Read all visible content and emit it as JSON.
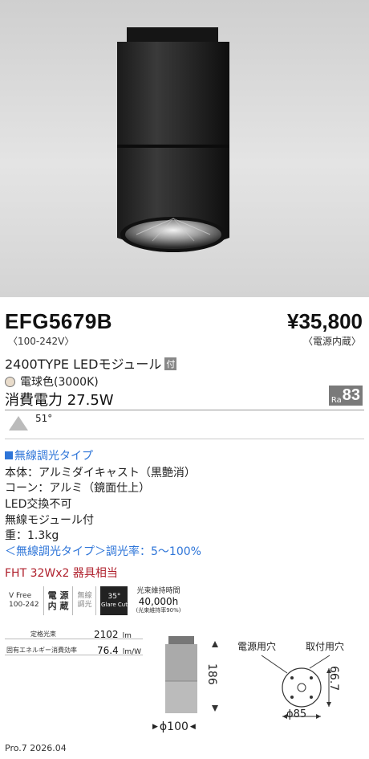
{
  "product": {
    "model": "EFG5679B",
    "voltage": "〈100-242V〉",
    "price": "¥35,800",
    "price_note": "〈電源内蔵〉",
    "type": "2400TYPE LEDモジュール",
    "type_badge": "付",
    "color": "電球色(3000K)",
    "power": "消費電力 27.5W",
    "ra_label": "Ra",
    "ra_value": "83",
    "beam_angle": "51°"
  },
  "specs": {
    "dimming_heading": "無線調光タイプ",
    "body": "本体：アルミダイキャスト（黒艶消）",
    "cone": "コーン：アルミ（鏡面仕上）",
    "led": "LED交換不可",
    "wireless": "無線モジュール付",
    "weight": "重：1.3kg",
    "dim_rate": "＜無線調光タイプ＞調光率：5～100%",
    "fht": "FHT 32Wx2 器具相当"
  },
  "feature_icons": {
    "vfree_top": "V Free",
    "vfree_bottom": "100-242",
    "power_top": "電 源",
    "power_bottom": "内 蔵",
    "wireless_top": "無線",
    "wireless_bottom": "調光",
    "glare_angle": "35°",
    "glare_label": "Glare Cut",
    "life_label": "光束維持時間",
    "life_value": "40,000h",
    "life_note": "(光束維持率90%)"
  },
  "performance": {
    "flux_label": "定格光束",
    "flux_value": "2102",
    "flux_unit": "lm",
    "eff_label": "固有エネルギー消費効率",
    "eff_value": "76.4",
    "eff_unit": "lm/W"
  },
  "dimensions": {
    "height": "186",
    "diameter": "ϕ100",
    "power_hole_label": "電源用穴",
    "mount_hole_label": "取付用穴",
    "pitch": "66.7",
    "hole_dia": "ϕ85"
  },
  "footer": "Pro.7 2026.04"
}
